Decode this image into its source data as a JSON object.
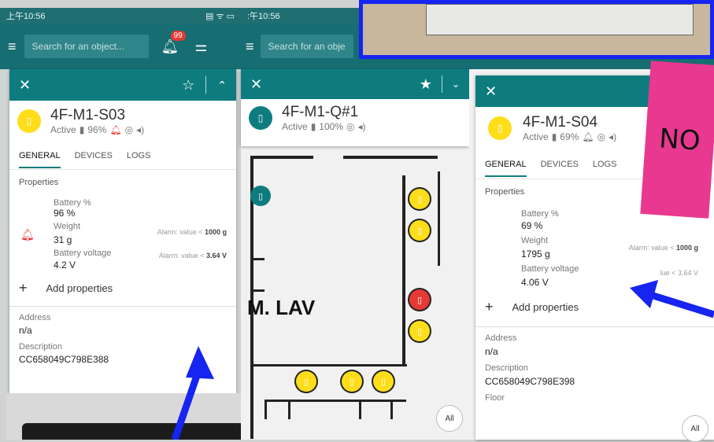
{
  "left_panel": {
    "status_time": "上午10:56",
    "search_placeholder": "Search for an object...",
    "notification_count": "99",
    "card": {
      "title": "4F-M1-S03",
      "status": "Active",
      "battery": "96%",
      "tabs": [
        "GENERAL",
        "DEVICES",
        "LOGS"
      ],
      "properties_label": "Properties",
      "battery_label": "Battery %",
      "battery_value": "96 %",
      "weight_label": "Weight",
      "weight_value": "31 g",
      "weight_alarm_prefix": "Alarm: value < ",
      "weight_alarm_value": "1000 g",
      "voltage_label": "Battery voltage",
      "voltage_value": "4.2 V",
      "voltage_alarm_prefix": "Alarm: value < ",
      "voltage_alarm_value": "3.64 V",
      "add_properties": "Add properties",
      "address_label": "Address",
      "address_value": "n/a",
      "description_label": "Description",
      "description_value": "CC658049C798E388"
    }
  },
  "middle_panel": {
    "status_time": ":午10:56",
    "search_placeholder": "Search for an obje",
    "card": {
      "title": "4F-M1-Q#1",
      "status": "Active",
      "battery": "100%"
    },
    "map_label": "M. LAV",
    "all_button": "All"
  },
  "right_panel": {
    "card": {
      "title": "4F-M1-S04",
      "status": "Active",
      "battery": "69%",
      "tabs": [
        "GENERAL",
        "DEVICES",
        "LOGS"
      ],
      "properties_label": "Properties",
      "battery_label": "Battery %",
      "battery_value": "69 %",
      "weight_label": "Weight",
      "weight_value": "1795 g",
      "weight_alarm_prefix": "Alarm: value < ",
      "weight_alarm_value": "1000 g",
      "voltage_label": "Battery voltage",
      "voltage_value": "4.06 V",
      "voltage_alarm_partial": "lue < 3.64 V",
      "add_properties": "Add properties",
      "address_label": "Address",
      "address_value": "n/a",
      "description_label": "Description",
      "description_value": "CC658049C798E398",
      "floor_label": "Floor"
    },
    "sticky_note_text": "NO",
    "all_button": "All"
  },
  "colors": {
    "teal_header": "#0e7c7f",
    "top_bar": "#166e72",
    "sensor_yellow": "#fedd1a",
    "alarm_red": "#e53935",
    "arrow_blue": "#1625f0"
  }
}
